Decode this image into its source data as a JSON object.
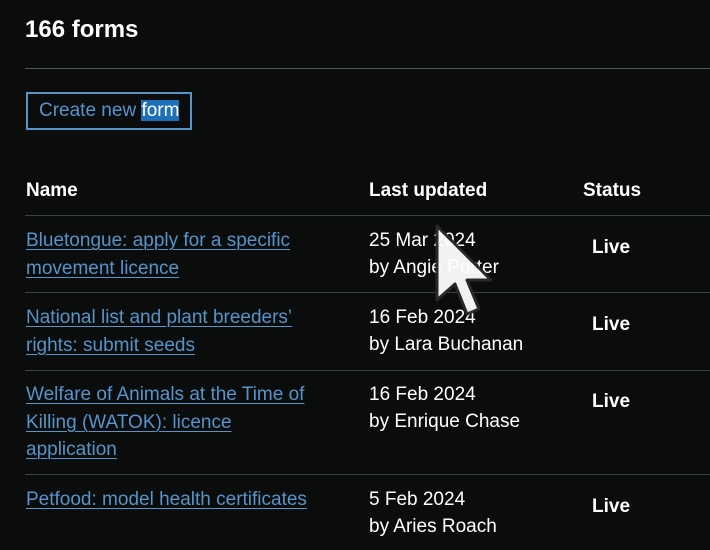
{
  "header": {
    "title": "166 forms",
    "create_button": {
      "label_main": "Create new ",
      "label_selected": "form"
    }
  },
  "table": {
    "columns": [
      "Name",
      "Last updated",
      "Status"
    ],
    "rows": [
      {
        "name_line1": "Bluetongue: apply for a specific",
        "name_line2": "movement licence",
        "name_line3": "",
        "date": "25 Mar 2024",
        "by": "by Angie Porter",
        "status": "Live"
      },
      {
        "name_line1": "National list and plant breeders’",
        "name_line2": "rights: submit seeds",
        "name_line3": "",
        "date": "16 Feb 2024",
        "by": "by Lara Buchanan",
        "status": "Live"
      },
      {
        "name_line1": "Welfare of Animals at the Time of",
        "name_line2": "Killing (WATOK): licence",
        "name_line3": "application",
        "date": "16 Feb 2024",
        "by": "by Enrique Chase",
        "status": "Live"
      },
      {
        "name_line1": "Petfood: model health certificates",
        "name_line2": "",
        "name_line3": "",
        "date": "5 Feb 2024",
        "by": "by Aries Roach",
        "status": "Live"
      }
    ]
  },
  "colors": {
    "background": "#0b0c0c",
    "link": "#5694ca",
    "text": "#ffffff",
    "selection": "#1d70b8"
  }
}
